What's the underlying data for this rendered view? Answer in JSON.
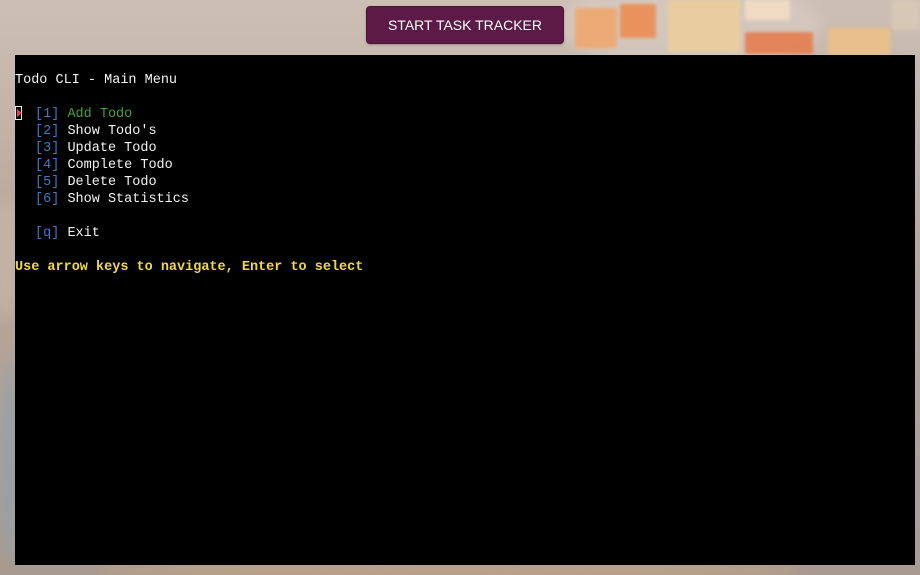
{
  "header": {
    "start_button_label": "START TASK TRACKER"
  },
  "terminal": {
    "title": "Todo CLI - Main Menu",
    "menu": [
      {
        "key": "1",
        "label": "Add Todo",
        "selected": true
      },
      {
        "key": "2",
        "label": "Show Todo's",
        "selected": false
      },
      {
        "key": "3",
        "label": "Update Todo",
        "selected": false
      },
      {
        "key": "4",
        "label": "Complete Todo",
        "selected": false
      },
      {
        "key": "5",
        "label": "Delete Todo",
        "selected": false
      },
      {
        "key": "6",
        "label": "Show Statistics",
        "selected": false
      }
    ],
    "exit": {
      "key": "q",
      "label": "Exit"
    },
    "hint": "Use arrow keys to navigate, Enter to select"
  },
  "colors": {
    "button_bg": "#5e1a46",
    "terminal_bg": "#000000",
    "selected_text": "#3ea43a",
    "key_text": "#3f7bc4",
    "hint_text": "#f2d64b",
    "cursor": "#e2452b"
  }
}
